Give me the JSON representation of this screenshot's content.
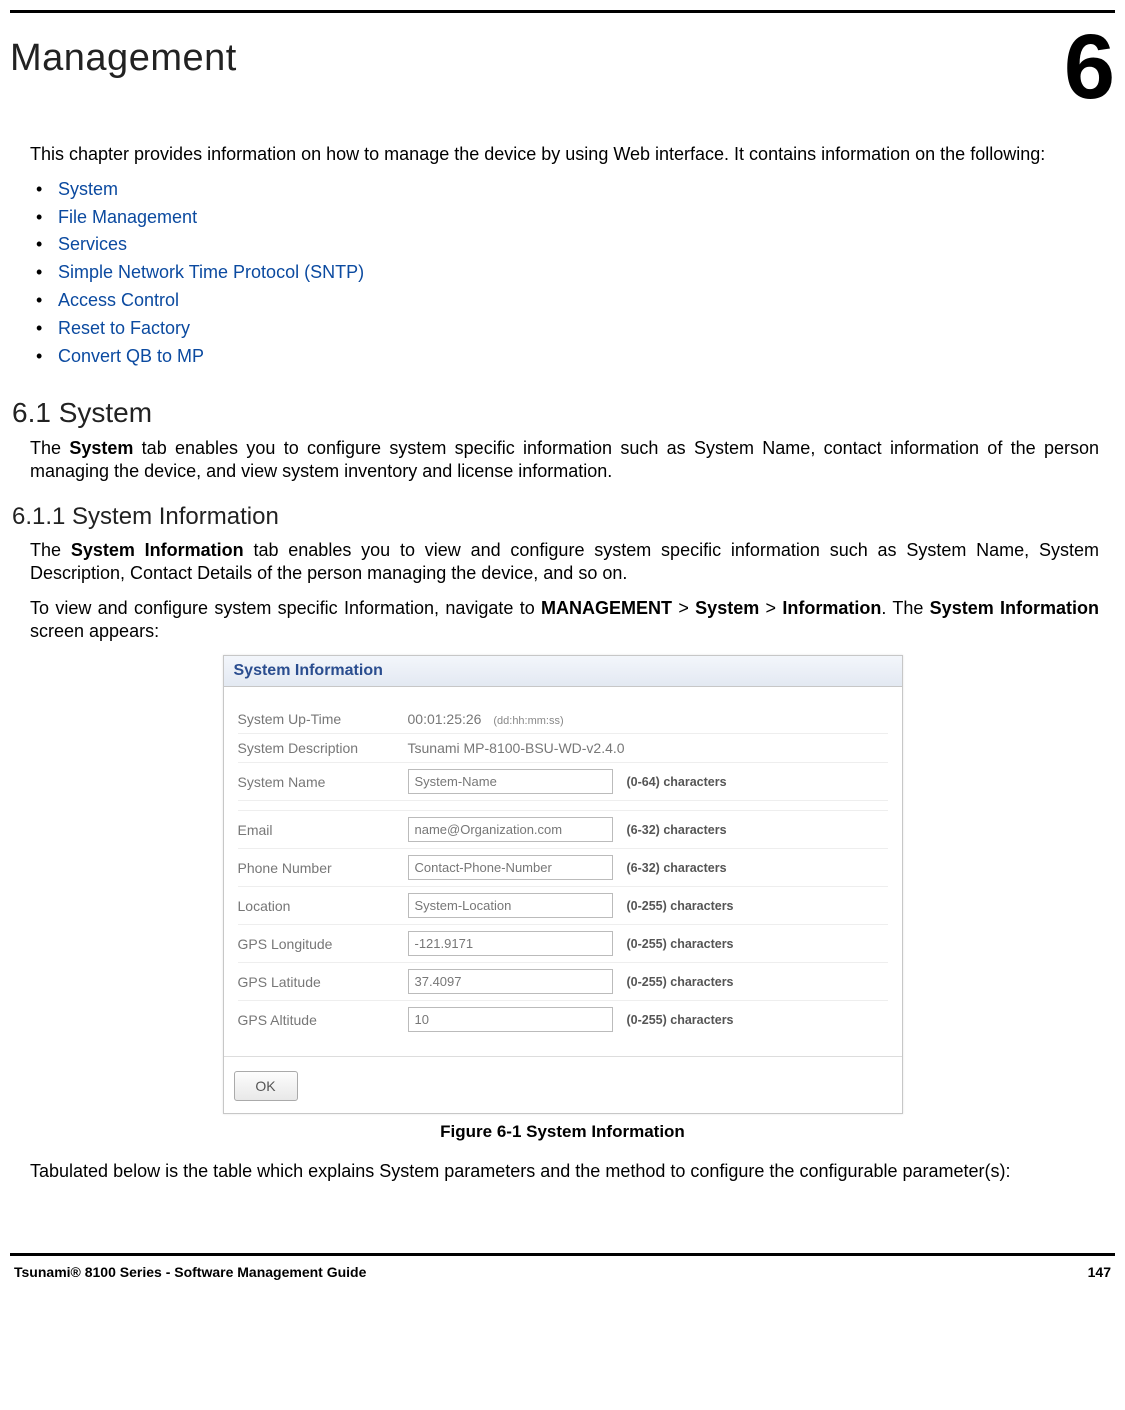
{
  "chapter": {
    "title": "Management",
    "number": "6"
  },
  "intro": "This chapter provides information on how to manage the device by using Web interface. It contains information on the following:",
  "links": [
    "System",
    "File Management",
    "Services",
    "Simple Network Time Protocol (SNTP)",
    "Access Control",
    "Reset to Factory",
    "Convert QB to MP"
  ],
  "section_6_1": {
    "heading": "6.1 System",
    "para_parts": [
      "The ",
      "System",
      " tab enables you to configure system specific information such as System Name, contact information of the person managing the device, and view system inventory and license information."
    ]
  },
  "section_6_1_1": {
    "heading": "6.1.1 System Information",
    "para1_parts": [
      "The ",
      "System Information",
      " tab enables you to view and configure system specific information such as System Name, System Description, Contact Details of the person managing the device, and so on."
    ],
    "para2_parts": [
      "To view and configure system specific Information, navigate to ",
      "MANAGEMENT",
      " > ",
      "System",
      " > ",
      "Information",
      ". The ",
      "System Information",
      " screen appears:"
    ]
  },
  "figure": {
    "panel_title": "System Information",
    "rows": {
      "uptime": {
        "label": "System Up-Time",
        "value": "00:01:25:26",
        "note": "(dd:hh:mm:ss)"
      },
      "description": {
        "label": "System Description",
        "value": "Tsunami MP-8100-BSU-WD-v2.4.0"
      },
      "name": {
        "label": "System Name",
        "value": "System-Name",
        "hint": "(0-64) characters"
      },
      "email": {
        "label": "Email",
        "value": "name@Organization.com",
        "hint": "(6-32) characters"
      },
      "phone": {
        "label": "Phone Number",
        "value": "Contact-Phone-Number",
        "hint": "(6-32) characters"
      },
      "location": {
        "label": "Location",
        "value": "System-Location",
        "hint": "(0-255) characters"
      },
      "lon": {
        "label": "GPS Longitude",
        "value": "-121.9171",
        "hint": "(0-255) characters"
      },
      "lat": {
        "label": "GPS Latitude",
        "value": "37.4097",
        "hint": "(0-255) characters"
      },
      "alt": {
        "label": "GPS Altitude",
        "value": "10",
        "hint": "(0-255) characters"
      }
    },
    "ok_label": "OK",
    "caption": "Figure 6-1 System Information"
  },
  "table_intro": "Tabulated below is the table which explains System parameters and the method to configure the configurable parameter(s):",
  "footer": {
    "guide": "Tsunami® 8100 Series - Software Management Guide",
    "page": "147"
  }
}
